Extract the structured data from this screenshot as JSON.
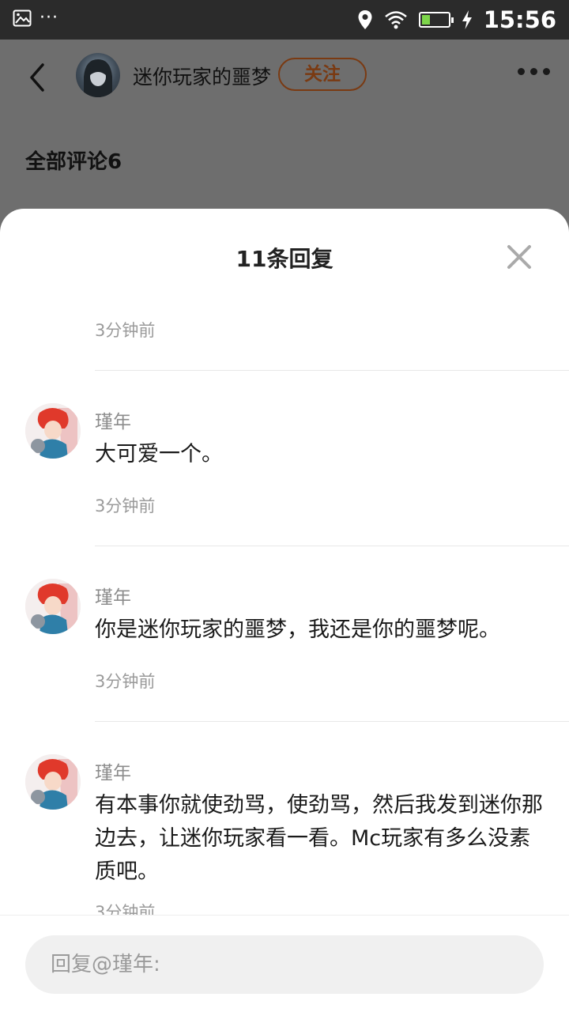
{
  "status_bar": {
    "time": "15:56",
    "icons": [
      "image-icon",
      "location-icon",
      "wifi-icon",
      "battery-icon",
      "charging-icon"
    ],
    "battery_level": 0.3,
    "dots": "···"
  },
  "header": {
    "author_name": "迷你玩家的噩梦",
    "follow_label": "关注",
    "follow_color": "#7a3a12"
  },
  "comments_header": "全部评论6",
  "sheet": {
    "title": "11条回复"
  },
  "replies": [
    {
      "time": "3分钟前"
    },
    {
      "name": "瑾年",
      "text": "大可爱一个。",
      "time": "3分钟前"
    },
    {
      "name": "瑾年",
      "text": "你是迷你玩家的噩梦，我还是你的噩梦呢。",
      "time": "3分钟前"
    },
    {
      "name": "瑾年",
      "text": "有本事你就使劲骂，使劲骂，然后我发到迷你那边去，让迷你玩家看一看。Mc玩家有多么没素质吧。",
      "time": "3分钟前"
    }
  ],
  "input": {
    "placeholder": "回复@瑾年:"
  }
}
